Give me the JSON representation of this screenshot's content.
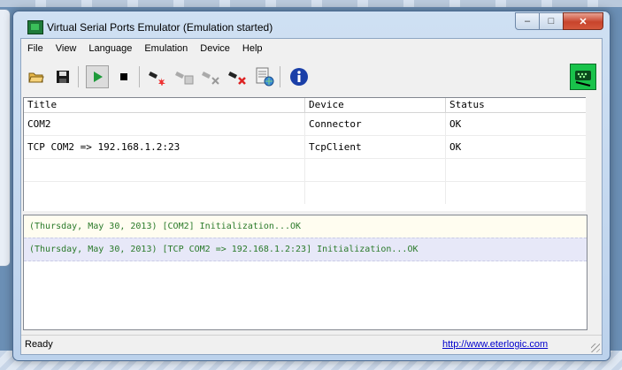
{
  "window": {
    "title": "Virtual Serial Ports Emulator (Emulation started)",
    "caption_buttons": {
      "minimize": "–",
      "maximize": "□",
      "close": "✕"
    }
  },
  "menubar": {
    "items": [
      {
        "label": "File"
      },
      {
        "label": "View"
      },
      {
        "label": "Language"
      },
      {
        "label": "Emulation"
      },
      {
        "label": "Device"
      },
      {
        "label": "Help"
      }
    ]
  },
  "toolbar": {
    "buttons": [
      {
        "icon": "open-folder-icon"
      },
      {
        "icon": "save-icon"
      },
      {
        "icon": "play-icon",
        "state": "pressed"
      },
      {
        "icon": "stop-icon"
      },
      {
        "icon": "create-device-icon"
      },
      {
        "icon": "edit-device-icon"
      },
      {
        "icon": "remove-device-icon"
      },
      {
        "icon": "delete-device-icon"
      },
      {
        "icon": "properties-icon"
      },
      {
        "icon": "info-icon"
      },
      {
        "icon": "serial-port-logo-icon"
      }
    ]
  },
  "devices": {
    "headers": [
      "Title",
      "Device",
      "Status"
    ],
    "rows": [
      [
        "COM2",
        "Connector",
        "OK"
      ],
      [
        "TCP COM2 => 192.168.1.2:23",
        "TcpClient",
        "OK"
      ]
    ]
  },
  "log": {
    "entries": [
      "(Thursday, May 30, 2013) [COM2] Initialization...OK",
      "(Thursday, May 30, 2013) [TCP COM2 => 192.168.1.2:23] Initialization...OK"
    ],
    "text_color": "#2a7a2a"
  },
  "statusbar": {
    "text": "Ready",
    "link": "http://www.eterlogic.com"
  },
  "colors": {
    "accent_green": "#19c34b",
    "info_blue": "#1a3fa8",
    "close_red": "#c8442c"
  }
}
